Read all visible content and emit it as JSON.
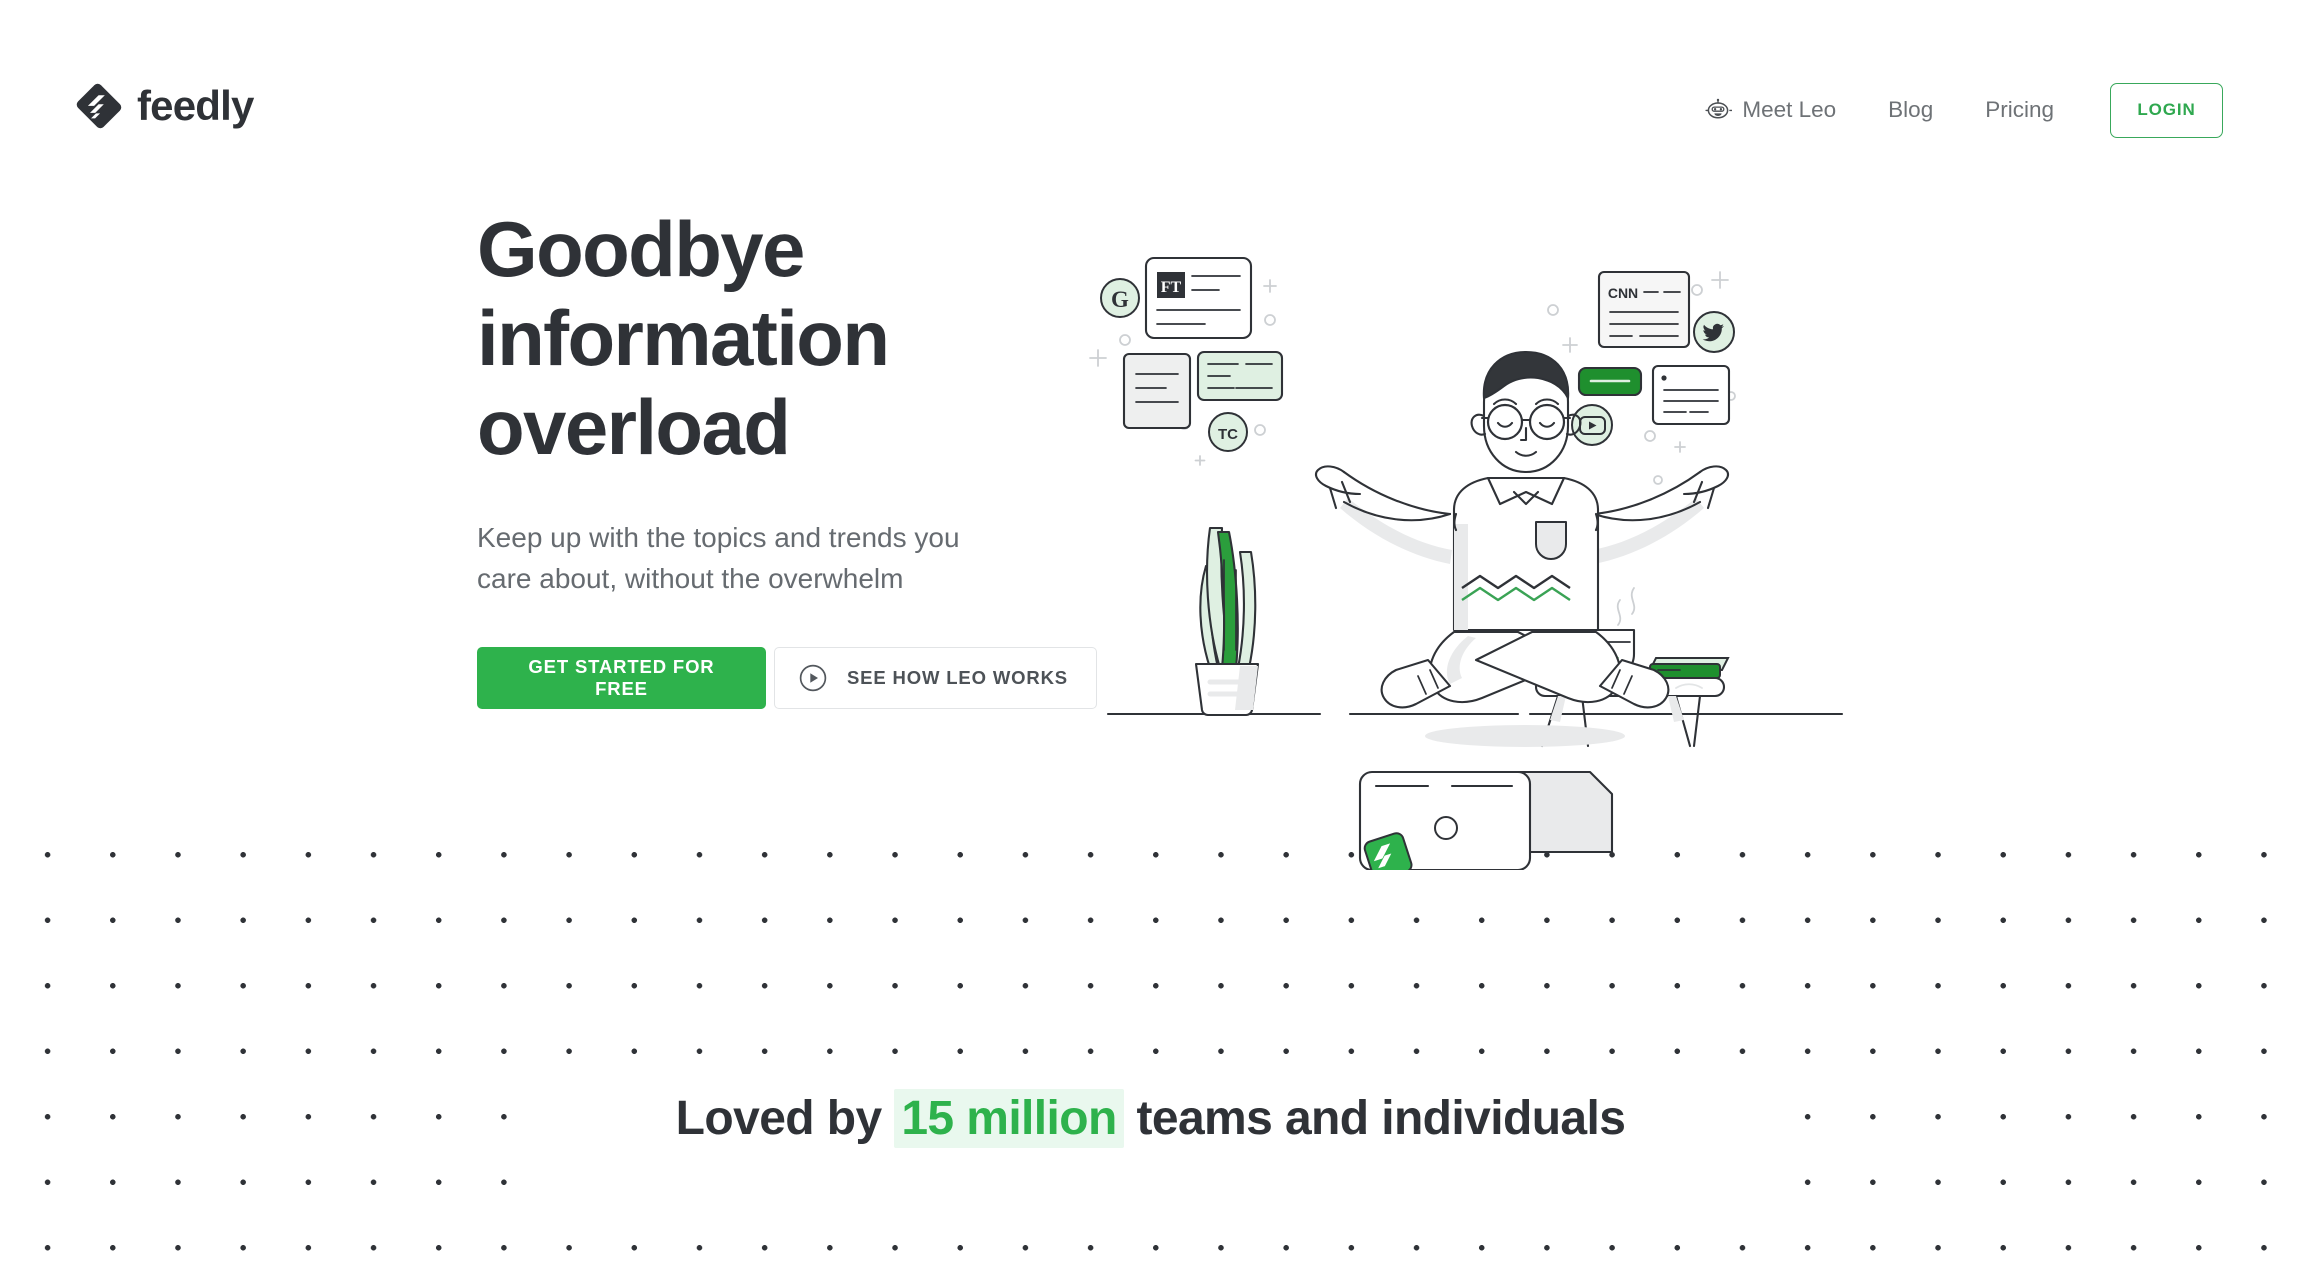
{
  "brand": {
    "name": "feedly",
    "mark_icon": "feedly-logo-icon"
  },
  "nav": {
    "items": [
      {
        "label": "Meet Leo",
        "icon": "robot-icon"
      },
      {
        "label": "Blog",
        "icon": null
      },
      {
        "label": "Pricing",
        "icon": null
      }
    ],
    "login_label": "LOGIN"
  },
  "hero": {
    "title_line1": "Goodbye",
    "title_line2": "information",
    "title_line3": "overload",
    "subtitle": "Keep up with the topics and trends you care about, without the overwhelm",
    "primary_cta": "GET STARTED FOR FREE",
    "secondary_cta": "SEE HOW LEO WORKS",
    "secondary_cta_icon": "play-circle-icon"
  },
  "illustration": {
    "name": "meditating-reader-illustration",
    "description": "Man meditating cross-legged surrounded by floating news cards and source badges",
    "badges": [
      "G",
      "TC",
      "Twitter",
      "YouTube"
    ],
    "cards": [
      "FT",
      "CNN"
    ],
    "props": [
      "potted-plant",
      "side-table",
      "teacup",
      "books",
      "laptop"
    ]
  },
  "social_proof": {
    "prefix": "Loved by",
    "highlight": "15 million",
    "suffix": "teams and individuals"
  },
  "colors": {
    "brand_green": "#2eb24c",
    "login_green": "#2fa84f",
    "highlight_bg": "#e9f8ee",
    "ink": "#2f3237",
    "muted": "#666b70",
    "nav_link": "#6e7276"
  }
}
